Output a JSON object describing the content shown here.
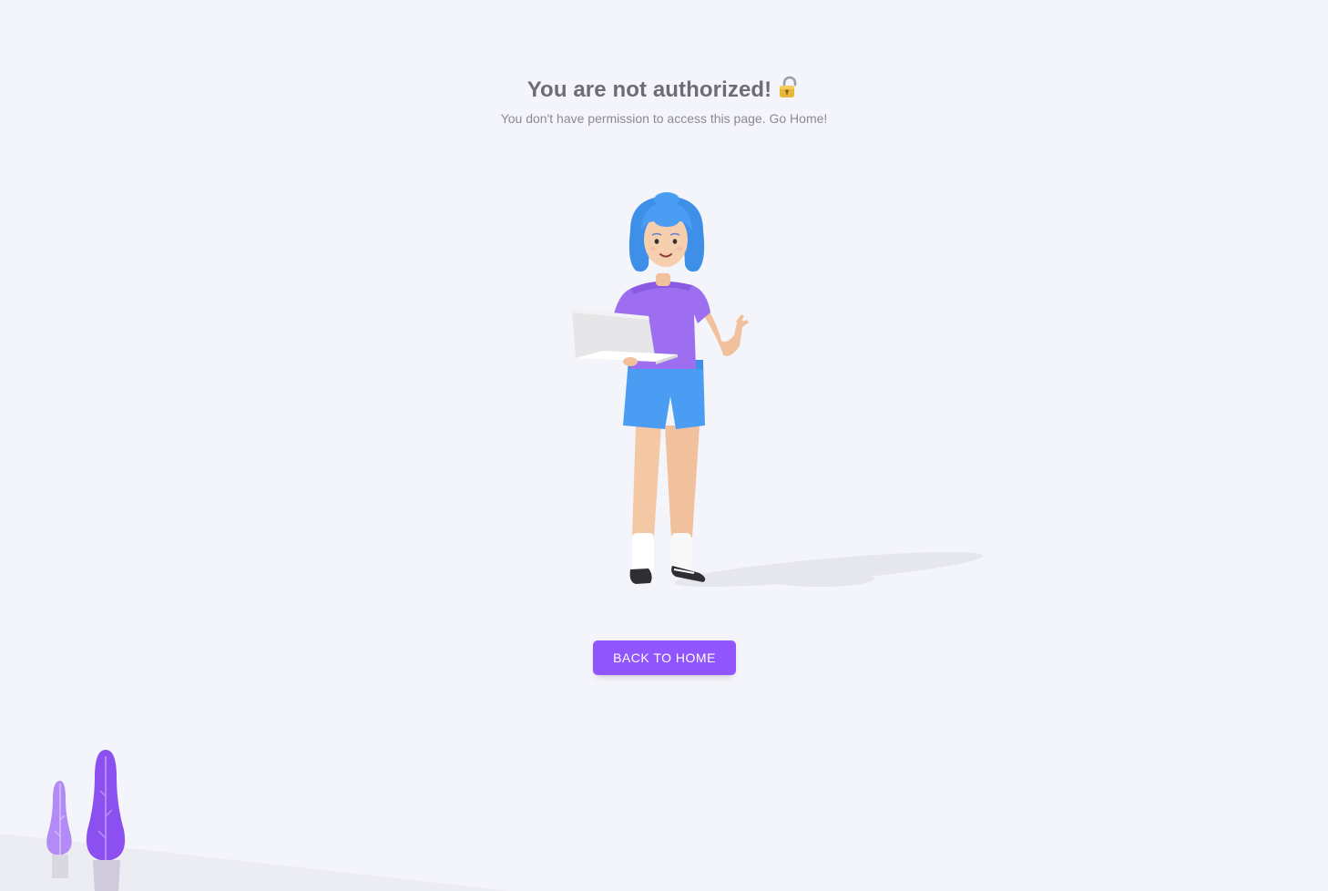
{
  "main": {
    "title": "You are not authorized!",
    "subtitle": "You don't have permission to access this page. Go Home!",
    "back_button_label": "BACK TO HOME"
  },
  "icons": {
    "title_icon": "lock-icon"
  },
  "colors": {
    "background": "#f4f5fa",
    "primary": "#9155fd",
    "title": "#6d6b77",
    "subtitle": "#8a8896"
  }
}
